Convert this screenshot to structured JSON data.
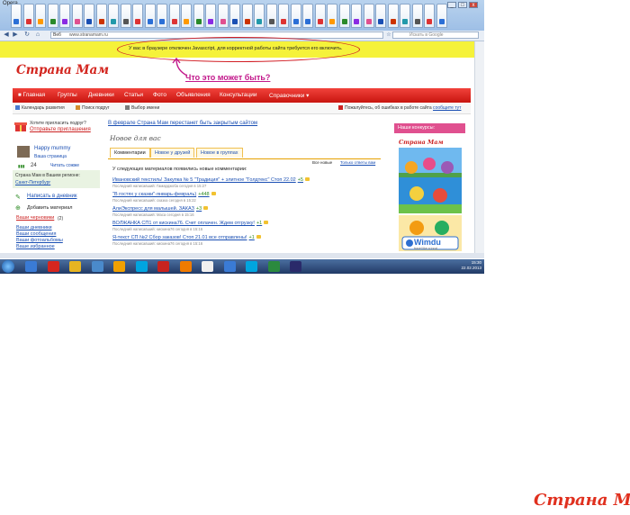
{
  "browser": {
    "app_name": "Opera",
    "tab_icon_colors": [
      "#2b6fd6",
      "#d33",
      "#ff9900",
      "#2a8a2a",
      "#8a2be2",
      "#e0508f",
      "#1a4fb3",
      "#cc3300",
      "#2299aa",
      "#555555",
      "#d33",
      "#2b6fd6"
    ],
    "address_prefix": "Веб",
    "address_url": "www.stranamam.ru",
    "search_placeholder": "Искать в Google",
    "window_buttons": [
      "_",
      "□",
      "x"
    ]
  },
  "warning_bar": {
    "text": "У вас в браузере отключен Javascript, для корректной работы сайта требуется его включить."
  },
  "annotation": {
    "question": "Что это может быть?"
  },
  "site": {
    "logo": "Страна Мам",
    "menu": [
      "Главная",
      "Группы",
      "Дневники",
      "Статьи",
      "Фото",
      "Объявления",
      "Консультации",
      "Справочники ▾"
    ],
    "subbar": {
      "calendar": "Календарь развития",
      "search": "Поиск подруг",
      "choice": "Выбор имени",
      "error_note": "Пожалуйтесь, об ошибках в работе сайта",
      "error_link": "сообщите тут"
    }
  },
  "left": {
    "invite_prompt": "Хотите пригласить подруг?",
    "invite_link": "Отправьте приглашения",
    "username": "Happy mummy",
    "my_page": "Ваша страница",
    "rating": "24",
    "read_comments": "Читать сожже",
    "region_label": "Страна Мам в Вашем регионе:",
    "region_value": "Санкт-Петербург",
    "write_diary": "Написать в дневник",
    "add_material": "Добавить материал",
    "drafts": "Ваши черновики",
    "drafts_count": "(2)",
    "links": [
      "Ваши дневники",
      "Ваши сообщения",
      "Ваши фотоальбомы",
      "Ваше избранное"
    ]
  },
  "center": {
    "announcement": "В феврале Страна Мам перестанет быть закрытым сайтом",
    "section_title": "Новое для вас",
    "tabs": [
      "Комментарии",
      "Новое у друзей",
      "Новое в группах"
    ],
    "filter_all": "Все новые",
    "filter_replies": "Только ответы вам",
    "feed_intro": "У следующих материалов появились новые комментарии:",
    "feed": [
      {
        "title": "Ивановский текстиль! Закупка № 5 \"Традиция\" + элитное \"Голдтекс\" Стоп 22.02",
        "count": "+5",
        "meta": "Последний написавший: Гамарджоба сегодня в 15:27"
      },
      {
        "title": "\"В гостях у сказки\"-январь-февраль)",
        "count": "+448",
        "meta": "Последний написавший: сказка сегодня в 15:22"
      },
      {
        "title": "АлиЭкспресс для малышей. ЗАКАЗ",
        "count": "+3",
        "meta": "Последний написавший: Маса сегодня в 15:16"
      },
      {
        "title": "ВОЛЖАНКА СП1 от кискина76. Счет оплачен. Ждем отгрузку!",
        "count": "+1",
        "meta": "Последний написавший: кискина76 сегодня в 15:16"
      },
      {
        "title": "Я-текст СП №2 Сбор заказов! Стоп 21.01 все отправлены!",
        "count": "+1",
        "meta": "Последний написавший: кискина76 сегодня в 15:16"
      }
    ]
  },
  "right": {
    "contest_header": "Наши конкурсы:",
    "logo": "Страна Мам",
    "banner_text": "Wimdu",
    "banner_sub": "travel like a local"
  },
  "taskbar": {
    "time": "15:30",
    "date": "22.02.2013",
    "apps": [
      "ie",
      "opera",
      "folder",
      "media",
      "antivirus",
      "skype",
      "word",
      "firefox",
      "player",
      "ie2",
      "skype2",
      "utorrent",
      "ps"
    ],
    "app_colors": [
      "#3a7bd5",
      "#d6261f",
      "#e6b422",
      "#4a8acb",
      "#f0a000",
      "#00a5e0",
      "#c8231f",
      "#f07b00",
      "#f0f0f0",
      "#3a7bd5",
      "#00a5e0",
      "#2b8a3e",
      "#2a2a6a"
    ]
  },
  "watermark": "Страна Мам"
}
